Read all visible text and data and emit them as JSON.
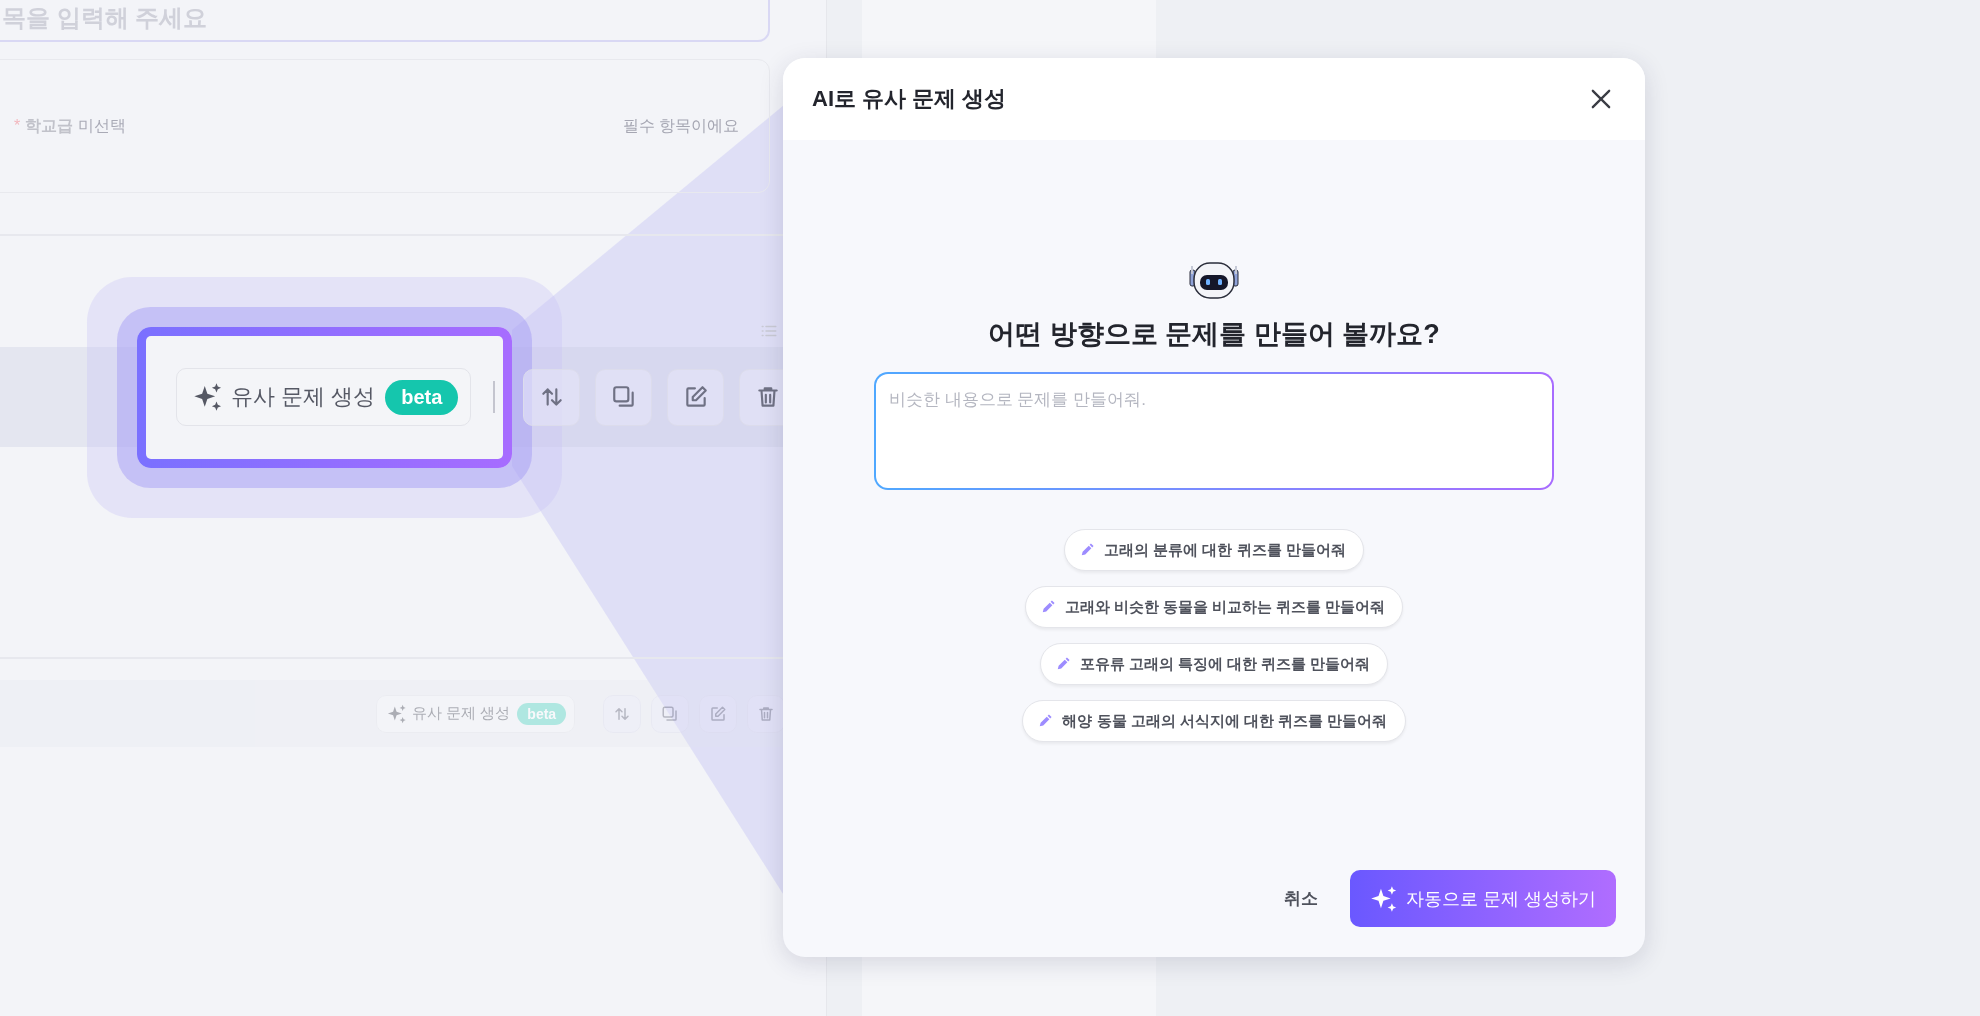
{
  "page": {
    "title_field": {
      "placeholder": "목을 입력해 주세요"
    },
    "school_level": {
      "required_mark": "*",
      "label": "학교급",
      "value": "미선택",
      "message": "필수 항목이에요"
    },
    "toolbars": [
      {
        "highlighted": true,
        "similar_button": {
          "label": "유사 문제 생성",
          "badge": "beta"
        }
      },
      {
        "highlighted": false,
        "similar_button": {
          "label": "유사 문제 생성",
          "badge": "beta"
        }
      }
    ]
  },
  "dialog": {
    "title": "AI로 유사 문제 생성",
    "heading": "어떤 방향으로 문제를 만들어 볼까요?",
    "prompt": {
      "placeholder": "비슷한 내용으로 문제를 만들어줘."
    },
    "suggestions": [
      "고래의 분류에 대한 퀴즈를 만들어줘",
      "고래와 비슷한 동물을 비교하는 퀴즈를 만들어줘",
      "포유류 고래의 특징에 대한 퀴즈를 만들어줘",
      "해양 동물 고래의 서식지에 대한 퀴즈를 만들어줘"
    ],
    "cancel": "취소",
    "submit": "자동으로 문제 생성하기"
  }
}
